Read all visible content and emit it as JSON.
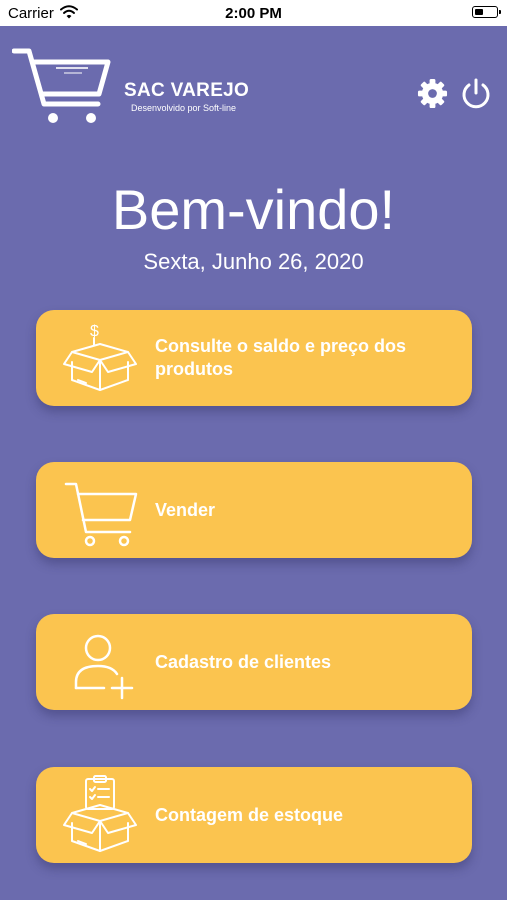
{
  "status_bar": {
    "carrier": "Carrier",
    "time": "2:00 PM",
    "battery_level": 0.4
  },
  "brand": {
    "title": "SAC VAREJO",
    "subtitle": "Desenvolvido por Soft-line"
  },
  "header_icons": {
    "settings": "gear-icon",
    "logout": "power-icon"
  },
  "welcome": {
    "title": "Bem-vindo!",
    "date": "Sexta, Junho 26, 2020"
  },
  "menu": [
    {
      "label": "Consulte o saldo e preço dos produtos",
      "icon": "box-dollar-icon"
    },
    {
      "label": "Vender",
      "icon": "cart-icon"
    },
    {
      "label": "Cadastro de clientes",
      "icon": "add-user-icon"
    },
    {
      "label": "Contagem de estoque",
      "icon": "box-checklist-icon"
    }
  ],
  "colors": {
    "background": "#6B6BAE",
    "card": "#FBC44F",
    "text": "#FFFFFF"
  }
}
